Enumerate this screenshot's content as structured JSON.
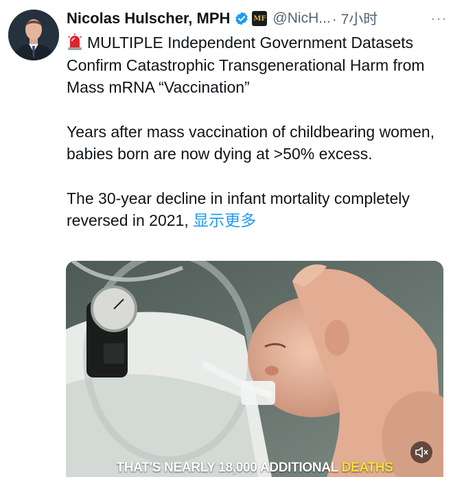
{
  "tweet": {
    "author_name": "Nicolas Hulscher, MPH",
    "handle": "@NicH...",
    "time": "· 7小时",
    "more_glyph": "···",
    "paragraphs": [
      "MULTIPLE Independent Government Datasets Confirm Catastrophic Transgenerational Harm from Mass mRNA “Vaccination”",
      "Years after mass vaccination of childbearing women, babies born are now dying at >50% excess.",
      "The 30-year decline in infant mortality completely reversed in 2021,"
    ],
    "show_more": "显示更多",
    "badge_text": "MF"
  },
  "media": {
    "caption_main": "THAT'S NEARLY 18,000 ADDITIONAL",
    "caption_highlight": "DEATHS"
  },
  "colors": {
    "link": "#1d9bf0",
    "verified": "#1d9bf0",
    "caption_highlight": "#f2e23a"
  },
  "icons": [
    "verified-badge-icon",
    "siren-emoji-icon",
    "more-options-icon",
    "mute-icon"
  ]
}
